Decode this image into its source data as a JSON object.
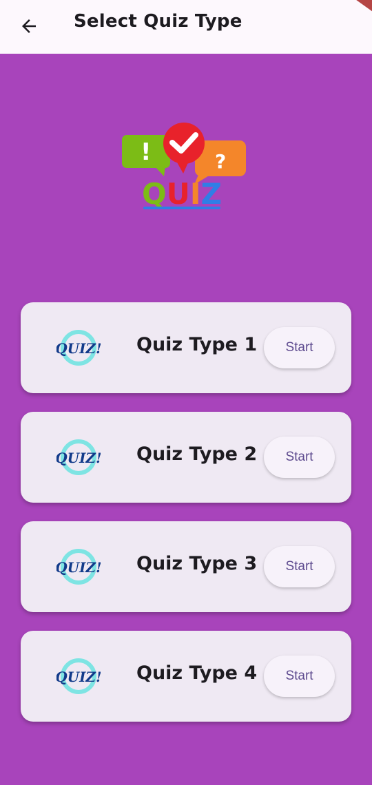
{
  "appbar": {
    "title": "Select Quiz Type",
    "back_icon": "arrow-left-icon"
  },
  "hero": {
    "logo_text": "QUIZ",
    "bubble_symbols": [
      "!",
      "?"
    ]
  },
  "quiz_types": [
    {
      "label": "Quiz Type 1",
      "button": "Start",
      "icon_text": "QUIZ!"
    },
    {
      "label": "Quiz Type 2",
      "button": "Start",
      "icon_text": "QUIZ!"
    },
    {
      "label": "Quiz Type 3",
      "button": "Start",
      "icon_text": "QUIZ!"
    },
    {
      "label": "Quiz Type 4",
      "button": "Start",
      "icon_text": "QUIZ!"
    }
  ],
  "colors": {
    "background": "#a844bb",
    "card": "#efe9f3",
    "accent": "#5e4b8f"
  }
}
